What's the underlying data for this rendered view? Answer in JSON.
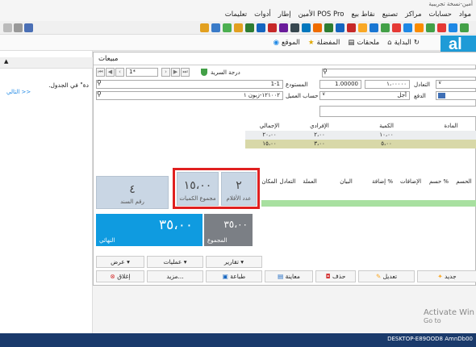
{
  "app": {
    "title_fragment": "أمين-نسخة تجريبية"
  },
  "menu": [
    "مواد",
    "حسابات",
    "مراكز",
    "تصنيع",
    "نقاط بيع",
    "الأمين POS Pro",
    "إطار",
    "أدوات",
    "تعليمات"
  ],
  "tabs": {
    "start": "البداية",
    "notes": "ملحقات",
    "favorites": "المفضلة",
    "site": "الموقع"
  },
  "left_panel": {
    "text": "دة\" في الجدول.",
    "link": "التالي >>"
  },
  "window": {
    "title": "مبيعات"
  },
  "header": {
    "security_label": "درجة السرية",
    "record_value": "1*",
    "warehouse_label": "المستودع",
    "warehouse_value": "1-1",
    "customer_label": "حساب العميل",
    "customer_value": "١٢١٠٠٢-زبون ١",
    "rate_label": "التعادل",
    "rate_value": "1.00000",
    "rate_value2": "١،٠٠٠٠٠",
    "payment_label": "الدفع",
    "payment_value": "آجل"
  },
  "top_grid": {
    "headers": [
      "الإجمالي",
      "الإفرادي",
      "الكمية",
      "المادة"
    ],
    "rows": [
      [
        "٢٠،٠٠",
        "٢،٠٠",
        "١٠،٠٠",
        ""
      ],
      [
        "١٥،٠٠",
        "٣،٠٠",
        "٥،٠٠",
        ""
      ]
    ]
  },
  "bottom_grid": {
    "headers": [
      "المكان",
      "التعادل",
      "العملة",
      "البيان",
      "إضافة %",
      "الإضافات",
      "حسم %",
      "الحسم"
    ]
  },
  "tiles": {
    "doc_label": "رقم السند",
    "doc_value": "٤",
    "qty_label": "مجموع الكميات",
    "qty_value": "١٥،٠٠",
    "count_label": "عدد الأقلام",
    "count_value": "٢"
  },
  "totals": {
    "total_label": "المجموع",
    "total_value": "٣٥،٠٠",
    "net_label": "النهائي",
    "net_value": "٣٥،٠٠"
  },
  "actions": {
    "reports": "تقارير",
    "operations": "عمليات",
    "view": "عرض",
    "new": "جديد",
    "edit": "تعديل",
    "delete": "حذف",
    "preview": "معاينة",
    "print": "طباعة",
    "more": "مزيد...",
    "close": "إغلاق"
  },
  "watermark": {
    "line1": "Activate Win",
    "line2": "Go to"
  },
  "taskbar": {
    "text": "DESKTOP-E89OOD8  AmnDb00"
  }
}
